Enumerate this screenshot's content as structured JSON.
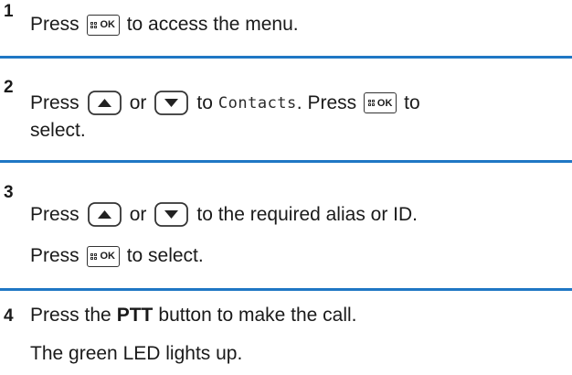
{
  "steps": [
    {
      "number": "1",
      "line1": {
        "pre": "Press",
        "post": "to access the menu."
      }
    },
    {
      "number": "2",
      "line1": {
        "pre": "Press",
        "or": "or",
        "to": "to",
        "lcd": "Contacts",
        "mid": ". Press",
        "post": "to"
      },
      "line2": "select."
    },
    {
      "number": "3",
      "line1": {
        "pre": "Press",
        "or": "or",
        "post": "to the required alias or ID."
      },
      "line2": {
        "pre": "Press",
        "post": "to select."
      }
    },
    {
      "number": "4",
      "line1": {
        "pre": "Press the",
        "bold": "PTT",
        "post": "button to make the call."
      },
      "line2": "The green LED lights up."
    }
  ],
  "icons": {
    "ok_key_label": "OK",
    "ok_key": "menu-ok-key-icon",
    "up_key": "up-arrow-key-icon",
    "down_key": "down-arrow-key-icon"
  },
  "colors": {
    "divider": "#1f77c4",
    "text": "#1a1a1a"
  }
}
